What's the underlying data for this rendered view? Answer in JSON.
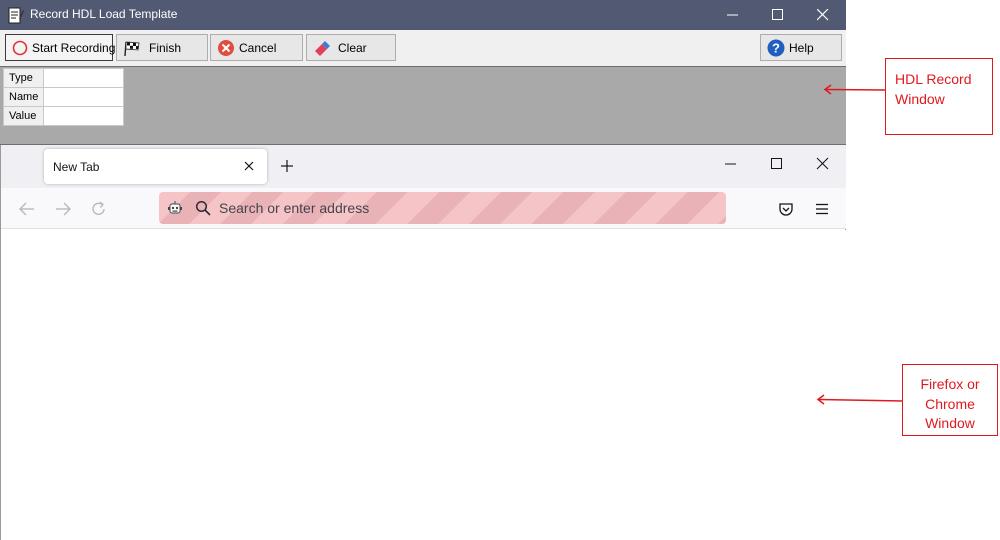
{
  "hdl": {
    "title": "Record HDL Load Template",
    "toolbar": {
      "start_recording": "Start Recording",
      "finish": "Finish",
      "cancel": "Cancel",
      "clear": "Clear",
      "help": "Help"
    },
    "properties": [
      {
        "key": "Type",
        "value": ""
      },
      {
        "key": "Name",
        "value": ""
      },
      {
        "key": "Value",
        "value": ""
      }
    ]
  },
  "browser": {
    "tab_label": "New Tab",
    "search_placeholder": "Search or enter address"
  },
  "annotations": {
    "hdl_window_lines": [
      "HDL Record",
      "Window"
    ],
    "browser_window_lines": [
      "Firefox or",
      "Chrome",
      "Window"
    ]
  },
  "colors": {
    "titlebar": "#525973",
    "annotation": "#e0191e",
    "urlbar_stripe_a": "#f5c4c7",
    "urlbar_stripe_b": "#e9b2b6"
  }
}
